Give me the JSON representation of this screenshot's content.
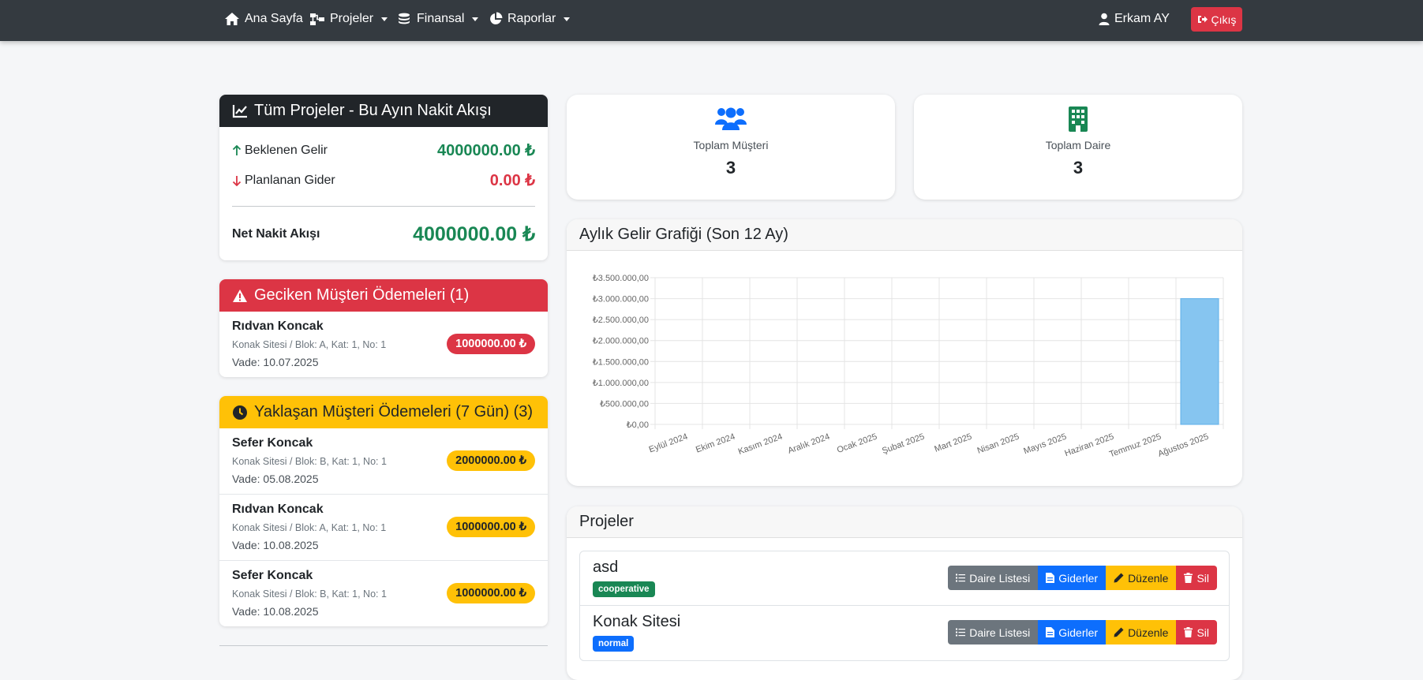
{
  "nav": {
    "home": "Ana Sayfa",
    "projects": "Projeler",
    "finance": "Finansal",
    "reports": "Raporlar",
    "user": "Erkam AY",
    "logout": "Çıkış"
  },
  "cashflow": {
    "title": "Tüm Projeler - Bu Ayın Nakit Akışı",
    "income_label": "Beklenen Gelir",
    "income_value": "4000000.00 ₺",
    "expense_label": "Planlanan Gider",
    "expense_value": "0.00 ₺",
    "net_label": "Net Nakit Akışı",
    "net_value": "4000000.00 ₺"
  },
  "late": {
    "title": "Geciken Müşteri Ödemeleri (1)",
    "items": [
      {
        "name": "Rıdvan Koncak",
        "location": "Konak Sitesi / Blok: A, Kat: 1, No: 1",
        "due": "Vade: 10.07.2025",
        "amount": "1000000.00 ₺"
      }
    ]
  },
  "upcoming": {
    "title": "Yaklaşan Müşteri Ödemeleri (7 Gün) (3)",
    "items": [
      {
        "name": "Sefer Koncak",
        "location": "Konak Sitesi / Blok: B, Kat: 1, No: 1",
        "due": "Vade: 05.08.2025",
        "amount": "2000000.00 ₺"
      },
      {
        "name": "Rıdvan Koncak",
        "location": "Konak Sitesi / Blok: A, Kat: 1, No: 1",
        "due": "Vade: 10.08.2025",
        "amount": "1000000.00 ₺"
      },
      {
        "name": "Sefer Koncak",
        "location": "Konak Sitesi / Blok: B, Kat: 1, No: 1",
        "due": "Vade: 10.08.2025",
        "amount": "1000000.00 ₺"
      }
    ]
  },
  "stats": {
    "customers_label": "Toplam Müşteri",
    "customers_value": "3",
    "flats_label": "Toplam Daire",
    "flats_value": "3",
    "customers_color": "#0d6efd",
    "flats_color": "#198754"
  },
  "chart_section": {
    "title": "Aylık Gelir Grafiği (Son 12 Ay)"
  },
  "chart_data": {
    "type": "bar",
    "categories": [
      "Eylül 2024",
      "Ekim 2024",
      "Kasım 2024",
      "Aralık 2024",
      "Ocak 2025",
      "Şubat 2025",
      "Mart 2025",
      "Nisan 2025",
      "Mayıs 2025",
      "Haziran 2025",
      "Temmuz 2025",
      "Ağustos 2025"
    ],
    "values": [
      0,
      0,
      0,
      0,
      0,
      0,
      0,
      0,
      0,
      0,
      0,
      3000000
    ],
    "ylim": [
      0,
      3500000
    ],
    "y_ticks": [
      "₺3.500.000,00",
      "₺3.000.000,00",
      "₺2.500.000,00",
      "₺2.000.000,00",
      "₺1.500.000,00",
      "₺1.000.000,00",
      "₺500.000,00",
      "₺0,00"
    ],
    "bar_color": "#86c5f0",
    "grid": true
  },
  "projects": {
    "title": "Projeler",
    "items": [
      {
        "name": "asd",
        "type": "cooperative"
      },
      {
        "name": "Konak Sitesi",
        "type": "normal"
      }
    ],
    "btn_flats": "Daire Listesi",
    "btn_expenses": "Giderler",
    "btn_edit": "Düzenle",
    "btn_delete": "Sil"
  }
}
